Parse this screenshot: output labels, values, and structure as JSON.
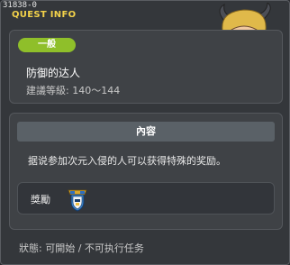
{
  "window": {
    "quest_id": "31838-0",
    "title": "QUEST INFO"
  },
  "info": {
    "badge": "一般",
    "quest_name": "防御的达人",
    "level_range": "建議等級: 140～144"
  },
  "content": {
    "header": "內容",
    "description": "据说参加次元入侵的人可以获得特殊的奖励。"
  },
  "reward": {
    "label": "獎勵",
    "item_icon": "shield-medal-icon"
  },
  "status": {
    "text": "狀態: 可開始 / 不可执行任务"
  },
  "colors": {
    "title": "#f3d24a",
    "badge": "#8fbf2a",
    "panel": "#3f4246",
    "background": "#34373b"
  }
}
